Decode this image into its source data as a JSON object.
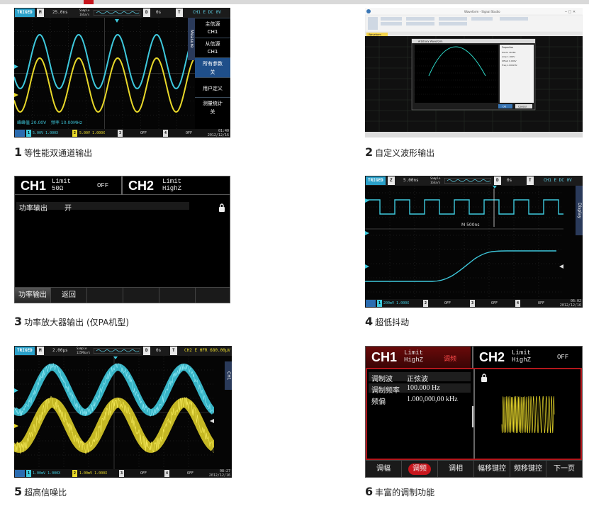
{
  "captions": [
    {
      "num": "1",
      "text": "等性能双通道输出"
    },
    {
      "num": "2",
      "text": "自定义波形输出"
    },
    {
      "num": "3",
      "text": "功率放大器输出 (仅PA机型)"
    },
    {
      "num": "4",
      "text": "超低抖动"
    },
    {
      "num": "5",
      "text": "超高信噪比"
    },
    {
      "num": "6",
      "text": "丰富的调制功能"
    }
  ],
  "colors": {
    "accent_red": "#c8161d",
    "cyan": "#3ec9dd",
    "yellow": "#e8d82a",
    "menu_blue": "#1f4f8a"
  },
  "panel1": {
    "top": {
      "trig": "TRIGED",
      "mode": "M",
      "timebase": "25.0ns",
      "sample": "Sample",
      "rate": "1GSa/s",
      "d": "D",
      "delay": "0s",
      "t": "T",
      "chinfo": "CH1 E DC 0V"
    },
    "side_tab": "Measure",
    "menu": [
      {
        "title": "主信源",
        "value": "CH1"
      },
      {
        "title": "从信源",
        "value": "CH1"
      },
      {
        "title": "所有参数",
        "value": "关"
      },
      {
        "title": "用户定义",
        "value": ""
      },
      {
        "title": "测量统计",
        "value": "关"
      }
    ],
    "meas1": "峰峰值 20.00V",
    "meas2": "频率 10.00MHz",
    "bottom": {
      "ch1": "1",
      "ch1v": "5.00V 1.000X",
      "ch2": "2",
      "ch2v": "5.00V 1.000X",
      "ch3": "3",
      "ch3v": "OFF",
      "ch4": "4",
      "ch4v": "OFF",
      "time": "01:40",
      "date": "2012/12/16"
    }
  },
  "panel2": {
    "app_title": "Waveform - Signal Studio",
    "tab": "Waveform",
    "dialog_title": "Arbitrary Waveform",
    "prop_title": "Properties",
    "prop_rows": [
      "Points 16384",
      "Amp 1.000V",
      "Offset 0.000V",
      "Freq 1.000kHz"
    ],
    "ok": "OK",
    "cancel": "Cancel"
  },
  "panel3": {
    "ch1": "CH1",
    "ch1_limit": "Limit",
    "ch1_load": "50Ω",
    "ch1_state": "OFF",
    "ch2": "CH2",
    "ch2_limit": "Limit",
    "ch2_load": "HighZ",
    "row_label": "功率输出",
    "row_value": "开",
    "btn1": "功率输出",
    "btn2": "返回"
  },
  "panel4": {
    "top": {
      "trig": "TRIGED",
      "mode": "Z",
      "timebase": "5.00ns",
      "sample": "Sample",
      "rate": "1GSa/s",
      "d": "D",
      "delay": "0s",
      "t": "T",
      "chinfo": "CH1 E DC 0V"
    },
    "zoom_label": "M 500ns",
    "side_tab": "Display",
    "bottom": {
      "ch1": "1",
      "ch1v": "200mV 1.000X",
      "ch2": "2",
      "ch2v": "OFF",
      "ch3": "3",
      "ch3v": "OFF",
      "ch4": "4",
      "ch4v": "OFF",
      "time": "06:02",
      "date": "2012/12/16"
    }
  },
  "panel5": {
    "top": {
      "trig": "TRIGED",
      "mode": "M",
      "timebase": "2.00μs",
      "sample": "Sample",
      "rate": "125MSa/s",
      "d": "D",
      "delay": "0s",
      "t": "T",
      "chinfo": "CH2 E HFR 680.00μV"
    },
    "side_tab": "CH1",
    "bottom": {
      "ch1": "1",
      "ch1v": "1.00mV 1.000X",
      "ch2": "2",
      "ch2v": "1.00mV 1.000X",
      "ch3": "3",
      "ch3v": "OFF",
      "ch4": "4",
      "ch4v": "OFF",
      "time": "08:27",
      "date": "2012/12/16"
    }
  },
  "panel6": {
    "ch1": "CH1",
    "ch1_limit": "Limit",
    "ch1_load": "HighZ",
    "ch1_mode": "调频",
    "ch2": "CH2",
    "ch2_limit": "Limit",
    "ch2_load": "HighZ",
    "ch2_state": "OFF",
    "rows": [
      {
        "label": "调制波",
        "value": "正弦波"
      },
      {
        "label": "调制频率",
        "value": "100.000 Hz"
      },
      {
        "label": "频偏",
        "value": "1.000,000,00 kHz"
      }
    ],
    "buttons": [
      "调幅",
      "调频",
      "调相",
      "幅移键控",
      "频移键控",
      "下一页"
    ]
  }
}
